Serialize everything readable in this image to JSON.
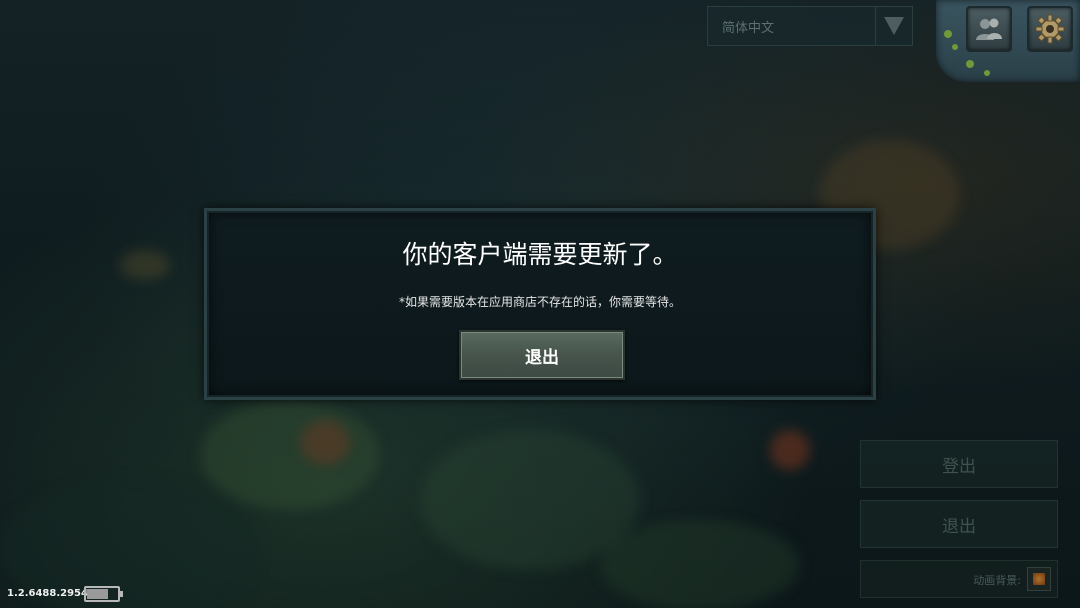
{
  "language_select": {
    "value": "简体中文"
  },
  "top_icons": {
    "friends_icon": "friends-icon",
    "settings_icon": "gear-icon"
  },
  "update_dialog": {
    "title": "你的客户端需要更新了。",
    "note": "*如果需要版本在应用商店不存在的话，你需要等待。",
    "exit_label": "退出"
  },
  "side_menu": {
    "login_label": "登出",
    "quit_label": "退出",
    "animated_bg_label": "动画背景:"
  },
  "footer": {
    "version": "1.2.6488.29542",
    "battery_level": 0.7
  },
  "colors": {
    "dialog_bg": "#0f1c20",
    "dialog_border": "#2b4145",
    "button_bg": "#4c5a52",
    "text_primary": "#ffffff"
  }
}
